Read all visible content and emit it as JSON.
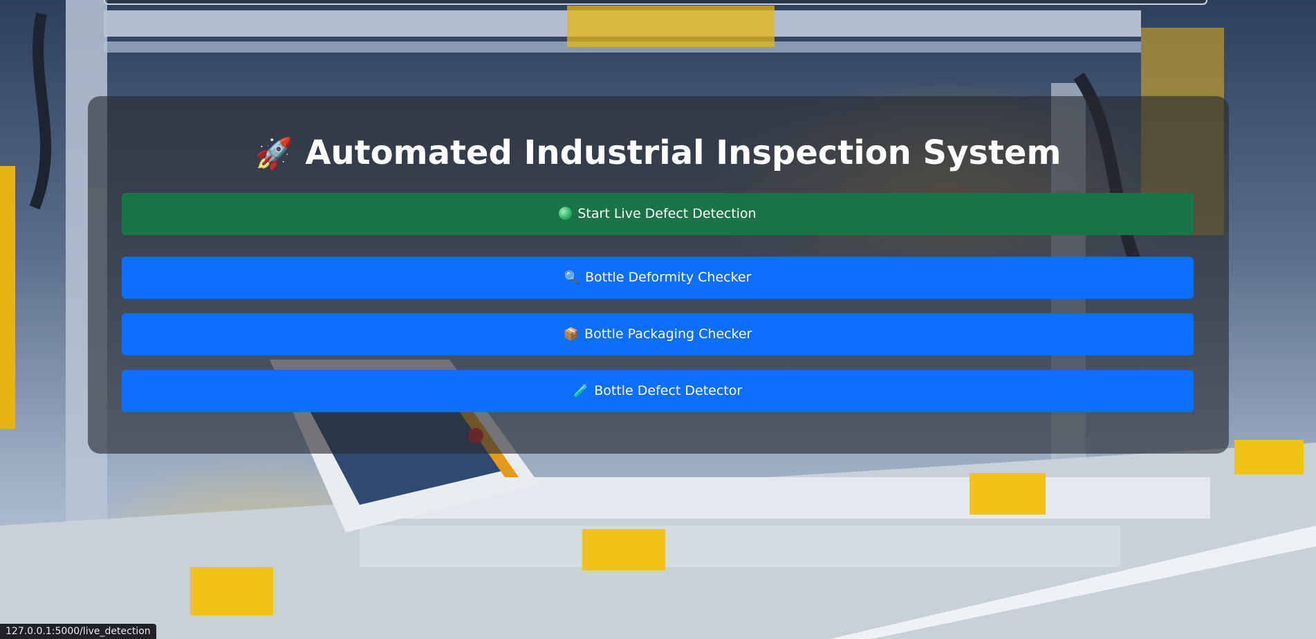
{
  "title": {
    "emoji": "🚀",
    "text": "Automated Industrial Inspection System"
  },
  "buttons": [
    {
      "icon": "green-circle",
      "label": "Start Live Defect Detection",
      "color": "#1a7448"
    },
    {
      "icon": "🔍",
      "label": "Bottle Deformity Checker",
      "color": "#0e6efd"
    },
    {
      "icon": "📦",
      "label": "Bottle Packaging Checker",
      "color": "#0e6efd"
    },
    {
      "icon": "🧪",
      "label": "Bottle Defect Detector",
      "color": "#0e6efd"
    }
  ],
  "status_bar": {
    "url": "127.0.0.1:5000/live_detection"
  }
}
